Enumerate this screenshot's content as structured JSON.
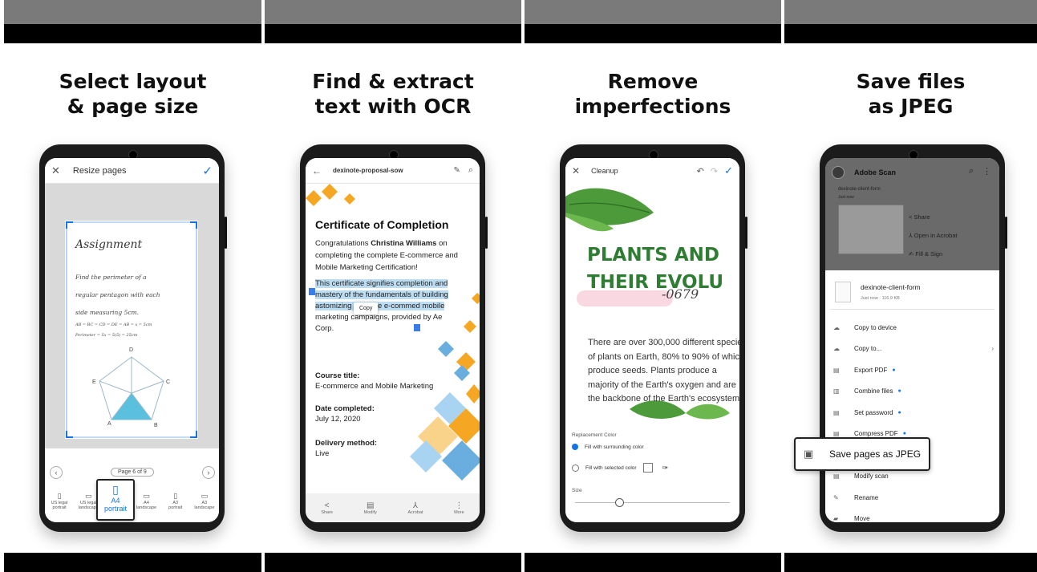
{
  "panels": [
    {
      "headline_1": "Select layout",
      "headline_2": "& page size",
      "screen": {
        "title": "Resize pages",
        "doc": {
          "title": "Assignment",
          "line1": "Find the perimeter of a",
          "line2": "regular pentagon with each",
          "line3": "side measuring 5cm.",
          "eq1": "AB = BC = CD = DE = AB = x = 5cm",
          "eq2": "Perimeter = 5x = 5(5) = 25cm",
          "v_d": "D",
          "v_e": "E",
          "v_c": "C",
          "v_a": "A",
          "v_b": "B"
        },
        "page_indicator": "Page 6 of 9",
        "sizes": [
          {
            "l1": "US legal",
            "l2": "portrait"
          },
          {
            "l1": "US legal",
            "l2": "landscape"
          },
          {
            "l1": "A4",
            "l2": "portrait"
          },
          {
            "l1": "A4",
            "l2": "landscape"
          },
          {
            "l1": "A3",
            "l2": "portrait"
          },
          {
            "l1": "A3",
            "l2": "landscape"
          }
        ]
      }
    },
    {
      "headline_1": "Find & extract",
      "headline_2": "text with OCR",
      "screen": {
        "title": "dexinote-proposal-sow",
        "cert_title": "Certificate of Completion",
        "congrats_pre": "Congratulations ",
        "congrats_name": "Christina Williams",
        "congrats_post": " on completing the complete E-commerce and Mobile Marketing Certification!",
        "selected_a": "This certificate signifies completion and mastery of the fundamentals of building a",
        "selected_b": "stomizing effective e-comme",
        "selected_c": "d mobile",
        "rest_a": " marketing campaigns, provided by A",
        "rest_b": "e Corp.",
        "copy_popup": "Copy",
        "course_label": "Course title:",
        "course_value": "E-commerce and Mobile Marketing",
        "date_label": "Date completed:",
        "date_value": "July 12, 2020",
        "delivery_label": "Delivery method:",
        "delivery_value": "Live",
        "bottom": [
          "Share",
          "Modify",
          "Acrobat",
          "More"
        ]
      }
    },
    {
      "headline_1": "Remove",
      "headline_2": "imperfections",
      "screen": {
        "title": "Cleanup",
        "big_1": "PLANTS AND",
        "big_2": "THEIR EVOLU",
        "scribble": "-0679",
        "body": "There are over 300,000 different species of plants on Earth, 80% to 90% of which produce seeds. Plants produce a majority of the Earth's oxygen and are the backbone of the Earth's ecosystem.",
        "rep_label": "Replacement Color",
        "opt1": "Fill with surrounding color",
        "opt2": "Fill with selected color",
        "size_label": "Size"
      }
    },
    {
      "headline_1": "Save files",
      "headline_2": "as JPEG",
      "screen": {
        "app_title": "Adobe Scan",
        "file_top": "dexinote-client-form",
        "file_top_time": "Just now",
        "ctx_share": "Share",
        "ctx_open": "Open in Acrobat",
        "ctx_fill": "Fill & Sign",
        "file_name": "dexinote-client-form",
        "file_meta": "Just now · 116.9 KB",
        "menu": [
          "Copy to device",
          "Copy to...",
          "Export PDF",
          "Combine files",
          "Set password",
          "Compress PDF",
          "Save pages as JPEG",
          "Modify scan",
          "Rename",
          "Move"
        ]
      }
    }
  ],
  "colors": {
    "accent_blue": "#1473e6",
    "selection": "#bcdcf2",
    "green_heading": "#2e7d32",
    "orange": "#f5a623",
    "diamond_blue": "#6aaee0"
  },
  "icons": [
    "close-icon",
    "check-icon",
    "back-arrow-icon",
    "pencil-icon",
    "search-icon",
    "undo-icon",
    "redo-icon",
    "share-icon",
    "more-icon",
    "cloud-upload-icon",
    "chevron-right-icon",
    "pdf-icon",
    "image-icon",
    "menu-dots-icon"
  ]
}
